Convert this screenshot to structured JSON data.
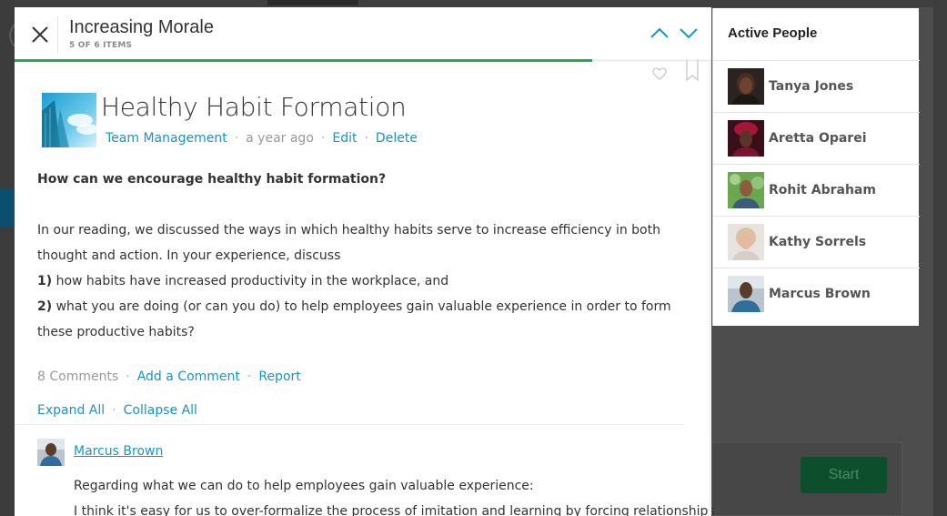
{
  "header": {
    "title": "Increasing Morale",
    "subtitle": "5 OF 6 ITEMS",
    "progress": 0.83
  },
  "post": {
    "title": "Healthy Habit Formation",
    "category": "Team Management",
    "timestamp": "a year ago",
    "edit_label": "Edit",
    "delete_label": "Delete",
    "question": "How can we encourage healthy habit formation?",
    "intro": "In our reading, we discussed the ways in which healthy habits serve to increase efficiency in both thought and action. In your experience, discuss",
    "item1_num": "1)",
    "item1_text": " how habits have increased productivity in the workplace, and",
    "item2_num": "2)",
    "item2_text": " what you are doing (or can you do) to help employees gain valuable experience in order to form these productive habits?"
  },
  "actions": {
    "comments_count": "8 Comments",
    "add_comment": "Add a Comment",
    "report": "Report",
    "expand_all": "Expand All",
    "collapse_all": "Collapse All"
  },
  "comment": {
    "author": "Marcus Brown",
    "line1": "Regarding what we can do to help employees gain valuable experience:",
    "line2": "I think it's easy for us to over-formalize the process of imitation and learning by forcing relationships"
  },
  "people": {
    "title": "Active People",
    "list": [
      {
        "name": "Tanya Jones"
      },
      {
        "name": "Aretta Oparei"
      },
      {
        "name": "Rohit Abraham"
      },
      {
        "name": "Kathy Sorrels"
      },
      {
        "name": "Marcus Brown"
      }
    ]
  },
  "background": {
    "start_label": "Start"
  },
  "colors": {
    "accent": "#1795c9",
    "progress": "#28a855",
    "start_button": "#0d4f2c"
  }
}
